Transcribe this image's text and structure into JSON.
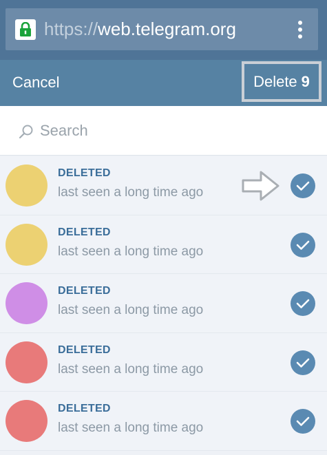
{
  "browser": {
    "url_scheme": "https://",
    "url_host": "web.telegram.org",
    "lock_icon": "lock-icon",
    "menu_icon": "more-vert-icon"
  },
  "action_bar": {
    "cancel_label": "Cancel",
    "delete_label": "Delete",
    "delete_count": "9"
  },
  "search": {
    "placeholder": "Search",
    "value": ""
  },
  "contacts": [
    {
      "name": "DELETED",
      "status": "last seen a long time ago",
      "avatar_color": "#ecd172",
      "selected": true
    },
    {
      "name": "DELETED",
      "status": "last seen a long time ago",
      "avatar_color": "#ecd172",
      "selected": true
    },
    {
      "name": "DELETED",
      "status": "last seen a long time ago",
      "avatar_color": "#cf8ee6",
      "selected": true
    },
    {
      "name": "DELETED",
      "status": "last seen a long time ago",
      "avatar_color": "#e87a7a",
      "selected": true
    },
    {
      "name": "DELETED",
      "status": "last seen a long time ago",
      "avatar_color": "#e87a7a",
      "selected": true
    }
  ],
  "colors": {
    "browser_bar": "#4f7497",
    "action_bar": "#5682a3",
    "accent_name": "#3a6d99",
    "check_fill": "#5a8ab2"
  }
}
